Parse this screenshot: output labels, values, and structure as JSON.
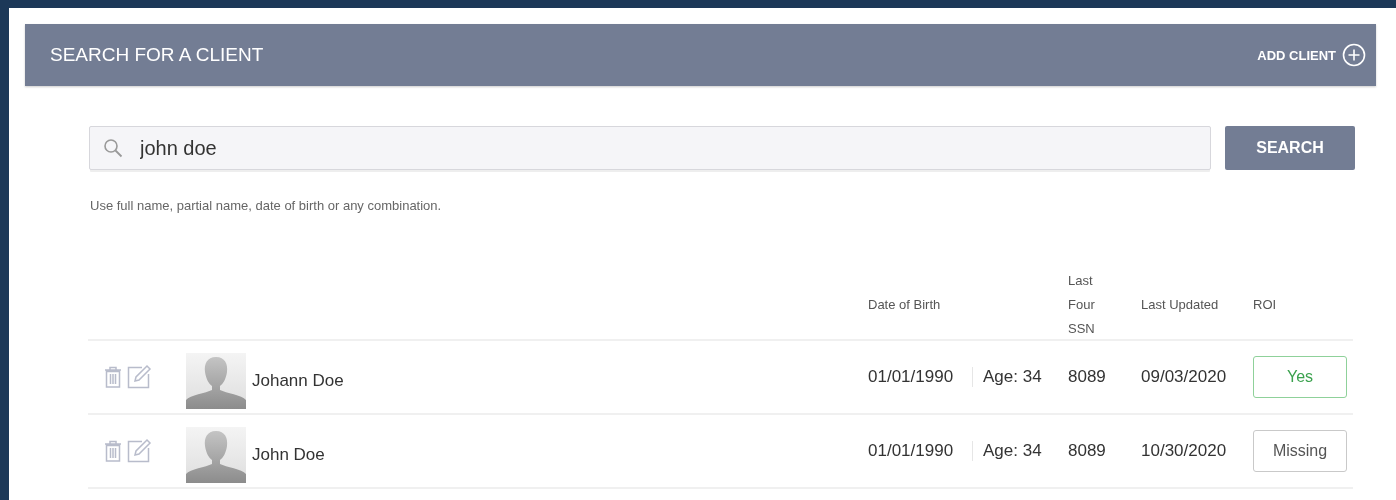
{
  "header": {
    "title": "SEARCH FOR A CLIENT",
    "add_button": "ADD CLIENT"
  },
  "search": {
    "value": "john doe",
    "button": "SEARCH",
    "hint": "Use full name, partial name, date of birth or any combination."
  },
  "table": {
    "columns": [
      "Date of Birth",
      "Last Four SSN",
      "Last Updated",
      "ROI"
    ],
    "rows": [
      {
        "name": "Johann Doe",
        "dob": "01/01/1990",
        "age": "Age: 34",
        "ssn": "8089",
        "updated": "09/03/2020",
        "roi": {
          "label": "Yes",
          "kind": "confirmed"
        }
      },
      {
        "name": "John Doe",
        "dob": "01/01/1990",
        "age": "Age: 34",
        "ssn": "8089",
        "updated": "10/30/2020",
        "roi": {
          "label": "Missing",
          "kind": "missing"
        }
      }
    ]
  }
}
